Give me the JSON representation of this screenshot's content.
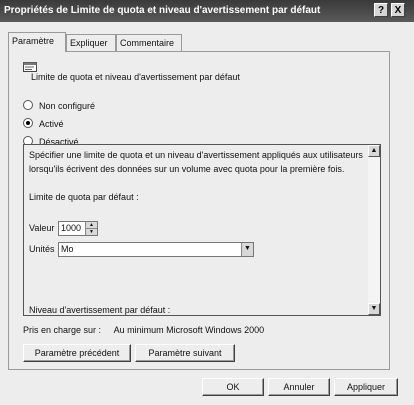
{
  "window": {
    "title": "Propriétés de Limite de quota et niveau d'avertissement par défaut",
    "help_glyph": "?",
    "close_glyph": "X"
  },
  "tabs": [
    {
      "label": "Paramètre",
      "active": true
    },
    {
      "label": "Expliquer",
      "active": false
    },
    {
      "label": "Commentaire",
      "active": false
    }
  ],
  "policy": {
    "name": "Limite de quota et niveau d'avertissement par défaut",
    "icon": "policy-setting-icon"
  },
  "state_options": [
    {
      "label": "Non configuré",
      "selected": false
    },
    {
      "label": "Activé",
      "selected": true
    },
    {
      "label": "Désactivé",
      "selected": false
    }
  ],
  "options_panel": {
    "description_line1": "Spécifier une limite de quota et un niveau d'avertissement appliqués aux utilisateurs",
    "description_line2": "lorsqu'ils écrivent des données sur un volume avec quota pour la première fois.",
    "quota_limit_heading": "Limite de quota par défaut :",
    "value_label": "Valeur",
    "value": "1000",
    "units_label": "Unités",
    "units_value": "Mo",
    "warning_heading": "Niveau d'avertissement par défaut :"
  },
  "supported_on": {
    "label": "Pris en charge sur :",
    "value": "Au minimum Microsoft Windows 2000"
  },
  "nav_buttons": {
    "previous": "Paramètre précédent",
    "next": "Paramètre suivant"
  },
  "dialog_buttons": {
    "ok": "OK",
    "cancel": "Annuler",
    "apply": "Appliquer"
  }
}
